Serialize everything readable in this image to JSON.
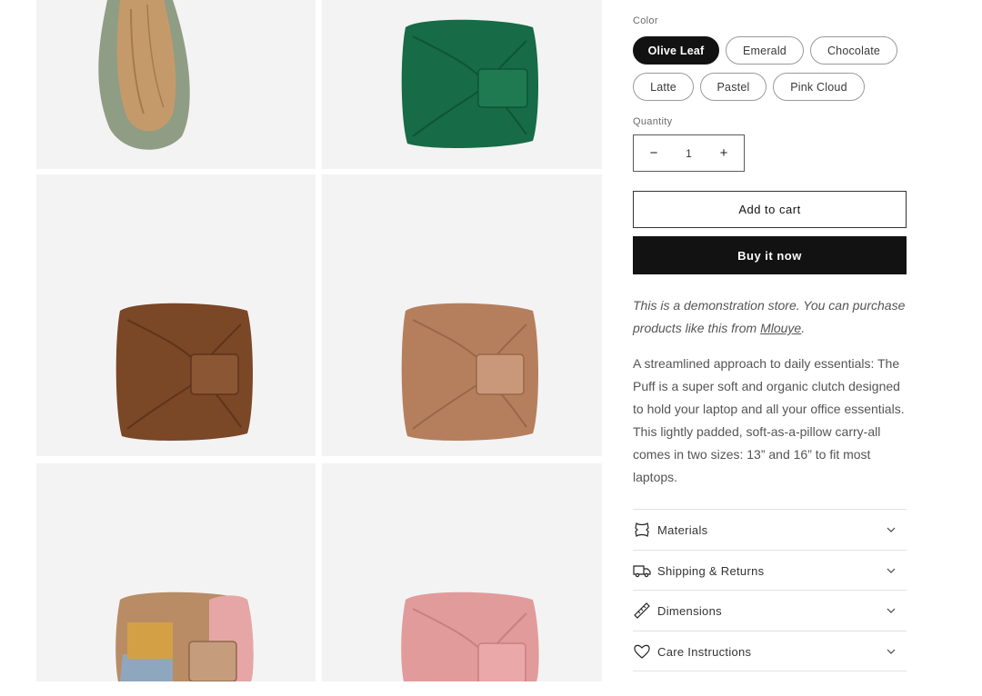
{
  "gallery": {
    "images": [
      {
        "name": "olive-leaf-open",
        "color": "#8f9d84"
      },
      {
        "name": "emerald",
        "color": "#176b47"
      },
      {
        "name": "chocolate",
        "color": "#7a4727"
      },
      {
        "name": "latte",
        "color": "#b57f5d"
      },
      {
        "name": "pastel",
        "color": "#b98c66"
      },
      {
        "name": "pink-cloud",
        "color": "#e29b9b"
      }
    ]
  },
  "product": {
    "color_label": "Color",
    "colors": [
      "Olive Leaf",
      "Emerald",
      "Chocolate",
      "Latte",
      "Pastel",
      "Pink Cloud"
    ],
    "selected_color": "Olive Leaf",
    "quantity_label": "Quantity",
    "quantity_value": "1",
    "decrease_symbol": "−",
    "increase_symbol": "+",
    "add_to_cart": "Add to cart",
    "buy_now": "Buy it now",
    "demo_text": "This is a demonstration store. You can purchase products like this from ",
    "demo_link": "Mlouye",
    "demo_end": ".",
    "description": "A streamlined approach to daily essentials: The Puff is a super soft and organic clutch designed to hold your laptop and all your office essentials. This lightly padded, soft-as-a-pillow carry-all comes in two sizes: 13” and 16” to fit most laptops."
  },
  "accordion": [
    {
      "label": "Materials",
      "icon": "leather-icon"
    },
    {
      "label": "Shipping & Returns",
      "icon": "truck-icon"
    },
    {
      "label": "Dimensions",
      "icon": "ruler-icon"
    },
    {
      "label": "Care Instructions",
      "icon": "heart-icon"
    }
  ],
  "colors": {
    "primary": "#121212",
    "text_muted": "#555555",
    "tile_bg": "#f3f3f3"
  }
}
